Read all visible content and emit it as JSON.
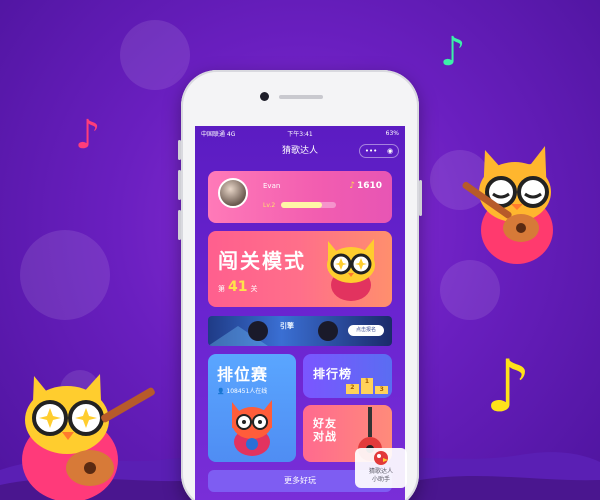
{
  "status_bar": {
    "carrier": "中国联通  4G",
    "time": "下午3:41",
    "battery": "63%"
  },
  "nav": {
    "title": "猜歌达人",
    "menu_glyph": "•••",
    "record_glyph": "◉"
  },
  "profile": {
    "name": "Evan",
    "level": "Lv.2",
    "level_progress": 0.75,
    "score": "1610"
  },
  "challenge": {
    "title": "闯关模式",
    "stage_prefix": "第",
    "stage_number": "41",
    "stage_suffix": "关"
  },
  "banner": {
    "logo_text": "引擎",
    "button_label": "点击报名"
  },
  "ranking": {
    "title": "排位赛",
    "online": "108451人在线"
  },
  "leaderboard": {
    "title": "排行榜",
    "podium": [
      "2",
      "1",
      "3"
    ]
  },
  "friends": {
    "title_line1": "好友",
    "title_line2": "对战"
  },
  "more": {
    "label": "更多好玩"
  },
  "assistant": {
    "line1": "猜歌达人",
    "line2": "小助手"
  },
  "colors": {
    "background": "#6a1fc0",
    "note_pink": "#ff3d7a",
    "note_green": "#3cf0a8",
    "note_yellow": "#ffe21a",
    "owl_body": "#f36a3c"
  }
}
